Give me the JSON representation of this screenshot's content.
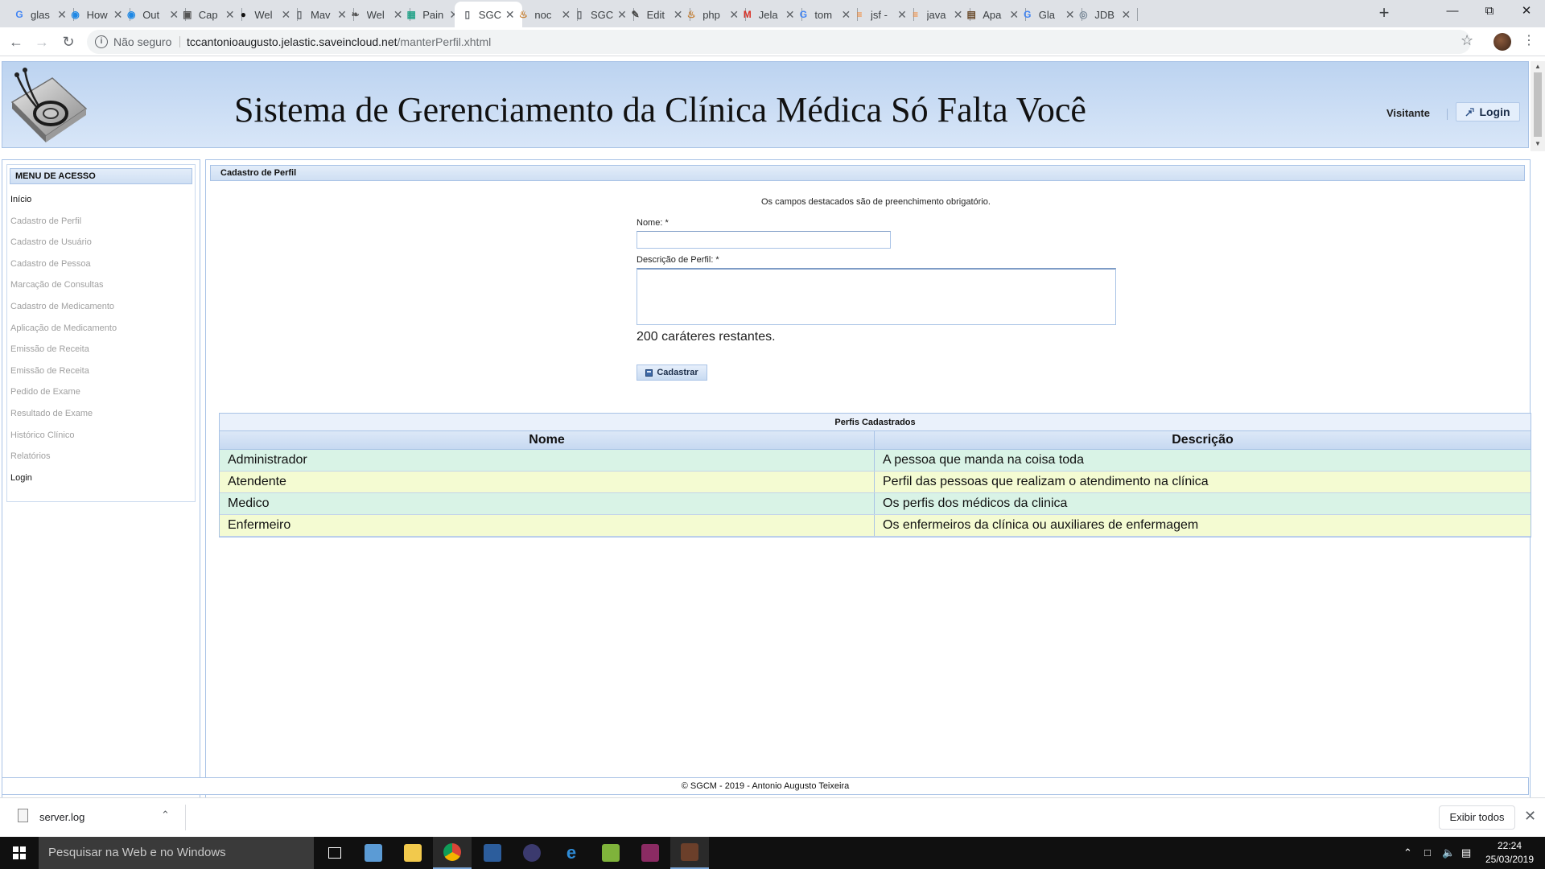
{
  "browser": {
    "tabs": [
      {
        "label": "glas",
        "icon": "google-icon",
        "active": false
      },
      {
        "label": "How",
        "icon": "edge-icon",
        "active": false
      },
      {
        "label": "Out",
        "icon": "edge-icon",
        "active": false
      },
      {
        "label": "Cap",
        "icon": "capture-icon",
        "active": false
      },
      {
        "label": "Wel",
        "icon": "github-icon",
        "active": false
      },
      {
        "label": "Mav",
        "icon": "page-icon",
        "active": false
      },
      {
        "label": "Wel",
        "icon": "feather-icon",
        "active": false
      },
      {
        "label": "Pain",
        "icon": "panel-icon",
        "active": false
      },
      {
        "label": "SGC",
        "icon": "page-icon",
        "active": true
      },
      {
        "label": "noc",
        "icon": "java-icon",
        "active": false
      },
      {
        "label": "SGC",
        "icon": "page-icon",
        "active": false
      },
      {
        "label": "Edit",
        "icon": "edit-icon",
        "active": false
      },
      {
        "label": "php",
        "icon": "java-icon",
        "active": false
      },
      {
        "label": "Jela",
        "icon": "gmail-icon",
        "active": false
      },
      {
        "label": "tom",
        "icon": "google-icon",
        "active": false
      },
      {
        "label": "jsf -",
        "icon": "stack-icon",
        "active": false
      },
      {
        "label": "java",
        "icon": "stack-icon",
        "active": false
      },
      {
        "label": "Apa",
        "icon": "image-icon",
        "active": false
      },
      {
        "label": "Gla",
        "icon": "google-icon",
        "active": false
      },
      {
        "label": "JDB",
        "icon": "globe-icon",
        "active": false
      }
    ],
    "new_tab": "+",
    "security_label": "Não seguro",
    "url_host": "tccantonioaugusto.jelastic.saveincloud.net",
    "url_path": "/manterPerfil.xhtml"
  },
  "header": {
    "title": "Sistema de Gerenciamento da Clínica Médica Só Falta Você",
    "user": "Visitante",
    "login_label": "Login"
  },
  "menu": {
    "title": "MENU DE ACESSO",
    "items": [
      {
        "label": "Início",
        "enabled": true
      },
      {
        "label": "Cadastro de Perfil",
        "enabled": false
      },
      {
        "label": "Cadastro de Usuário",
        "enabled": false
      },
      {
        "label": "Cadastro de Pessoa",
        "enabled": false
      },
      {
        "label": "Marcação de Consultas",
        "enabled": false
      },
      {
        "label": "Cadastro de Medicamento",
        "enabled": false
      },
      {
        "label": "Aplicação de Medicamento",
        "enabled": false
      },
      {
        "label": "Emissão de Receita",
        "enabled": false
      },
      {
        "label": "Emissão de Receita",
        "enabled": false
      },
      {
        "label": "Pedido de Exame",
        "enabled": false
      },
      {
        "label": "Resultado de Exame",
        "enabled": false
      },
      {
        "label": "Histórico Clínico",
        "enabled": false
      },
      {
        "label": "Relatórios",
        "enabled": false
      },
      {
        "label": "Login",
        "enabled": true
      }
    ]
  },
  "form": {
    "panel_title": "Cadastro de Perfil",
    "required_note": "Os campos destacados são de preenchimento obrigatório.",
    "nome_label": "Nome: *",
    "nome_value": "",
    "descricao_label": "Descrição de Perfil: *",
    "descricao_value": "",
    "remaining": "200 caráteres restantes.",
    "submit_label": "Cadastrar"
  },
  "table": {
    "caption": "Perfis Cadastrados",
    "columns": [
      "Nome",
      "Descrição"
    ],
    "rows": [
      [
        "Administrador",
        "A pessoa que manda na coisa toda"
      ],
      [
        "Atendente",
        "Perfil das pessoas que realizam o atendimento na clínica"
      ],
      [
        "Medico",
        "Os perfis dos médicos da clinica"
      ],
      [
        "Enfermeiro",
        "Os enfermeiros da clínica ou auxiliares de enfermagem"
      ]
    ]
  },
  "footer": "© SGCM - 2019 - Antonio Augusto Teixeira",
  "downloads": {
    "file": "server.log",
    "show_all": "Exibir todos"
  },
  "taskbar": {
    "search_placeholder": "Pesquisar na Web e no Windows",
    "time": "22:24",
    "date": "25/03/2019"
  },
  "colors": {
    "header_bg": "#c8dcf4",
    "panel_border": "#a9c3e6",
    "row_odd": "#d9f3e6",
    "row_even": "#f4fbd2"
  }
}
